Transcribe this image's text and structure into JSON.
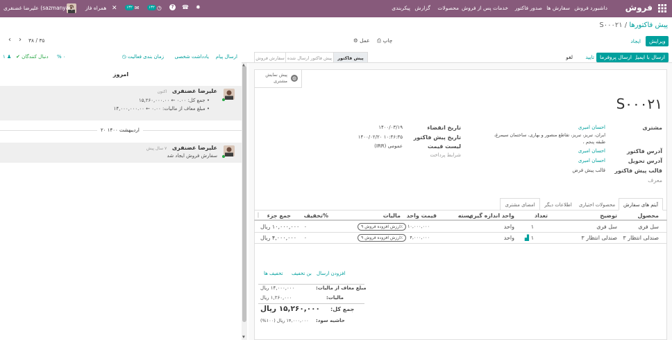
{
  "navbar": {
    "app": "فروش",
    "menus": [
      "داشبورد فروش",
      "سفارش ها",
      "صدور فاکتور",
      "خدمات پس از فروش",
      "محصولات",
      "گزارش",
      "پیکربندی"
    ],
    "company": "همراه فاز",
    "user": "علیرضا غضنفری (sazmanyar)",
    "badge_activities": "۱۳۲",
    "badge_messages": "۱۳۲"
  },
  "breadcrumb": {
    "parent": "پیش فاکتورها",
    "current": "S۰۰۰۲۱"
  },
  "toolbar": {
    "edit": "ویرایش",
    "create": "ایجاد",
    "print": "چاپ",
    "action": "عمل",
    "pager": "۳۸ / ۳۵"
  },
  "actions": {
    "send_email": "ارسال با ایمیل",
    "send_proforma": "ارسال پروفرما",
    "confirm": "تایید",
    "cancel": "لغو"
  },
  "statusbar": {
    "quotation": "پیش فاکتور",
    "sent": "پیش فاکتور ارسال شده",
    "order": "سفارش فروش"
  },
  "smart": {
    "customer_preview": "پیش نمایش",
    "customer_preview2": "مشتری"
  },
  "form": {
    "name": "S۰۰۰۲۱",
    "labels": {
      "customer": "مشتری",
      "invoice_address": "آدرس فاکتور",
      "delivery_address": "آدرس تحویل",
      "template": "قالب پیش فاکتور",
      "reference": "معرف",
      "expiration": "تاریخ انقضاء",
      "quotation_date": "تاریخ پیش فاکتور",
      "pricelist": "لیست قیمت",
      "payment_terms": "شرایط پرداخت"
    },
    "customer": "احسان امیری",
    "address1": "ایران، تبریز، تبریز، تقاطع منصور و بهاری، ساختمان سیمرغ،",
    "address2": "طبقه پنجم ،",
    "invoice_address": "احسان امیری",
    "delivery_address": "احسان امیری",
    "template": "قالب پیش فرض",
    "expiration": "۱۴۰۰/۰۳/۱۹",
    "quotation_date": "۱۴۰۰/۰۲/۲۰ ۱۰:۴۶:۳۵",
    "pricelist": "عمومی (IRR)"
  },
  "tabs": [
    "آیتم های سفارش",
    "محصولات اختیاری",
    "اطلاعات دیگر",
    "امضای مشتری"
  ],
  "table": {
    "headers": {
      "product": "محصول",
      "description": "توضیح",
      "qty": "تعداد",
      "uom": "واحد اندازه گیری",
      "package": "بسته",
      "price": "قیمت واحد",
      "taxes": "مالیات",
      "discount": "تخفیف%",
      "subtotal": "جمع جزء"
    },
    "rows": [
      {
        "product": "سل فری",
        "description": "سل فری",
        "qty": "۱",
        "uom": "واحد",
        "price": "۱۰,۰۰۰,۰۰۰",
        "tax": "ارزش افزوده فروش ۹٪",
        "discount": "۰",
        "subtotal": "۱۰,۰۰۰,۰۰۰ ریال"
      },
      {
        "product": "صندلی انتظار ۳",
        "description": "صندلی انتظار ۳",
        "qty": "۱",
        "uom": "واحد",
        "price": "۴,۰۰۰,۰۰۰",
        "tax": "ارزش افزوده فروش ۹٪",
        "discount": "۰",
        "subtotal": "۴,۰۰۰,۰۰۰ ریال"
      }
    ]
  },
  "links": {
    "add_shipping": "افزودن ارسال",
    "coupon": "بن تخفیف",
    "promotions": "تخفیف ها"
  },
  "totals": {
    "untaxed_label": "مبلغ معاف از مالیات:",
    "untaxed": "۱۴,۰۰۰,۰۰۰ ریال",
    "tax_label": "مالیات:",
    "tax": "۱,۲۶۰,۰۰۰ ریال",
    "total_label": "جمع کل:",
    "total": "۱۵,۲۶۰,۰۰۰ ریال",
    "margin_label": "حاشیه سود:",
    "margin": "۱۴,۰۰۰,۰۰۰ ریال (۱۰۰%)"
  },
  "chatter": {
    "send_message": "ارسال پیام",
    "log_note": "یادداشت شخصی",
    "schedule": "زمان بندی فعالیت",
    "attachments": "۰",
    "follow": "دنبال کنندگان",
    "followers": "۱",
    "today": "امروز",
    "date2": "۲۰ اردیبهشت ۱۴۰۰",
    "msg1": {
      "author": "علیرضا غضنفری",
      "time": "اکنون",
      "line1": "جمع کل: ۰.۰۰ ← ۱۵,۲۶۰,۰۰۰.۰۰",
      "line2": "مبلغ معاف از مالیات: ۰.۰۰ ← ۱۴,۰۰۰,۰۰۰.۰۰"
    },
    "msg2": {
      "author": "علیرضا غضنفری",
      "time": "۷ سال پیش",
      "body": "سفارش فروش ایجاد شد"
    }
  }
}
